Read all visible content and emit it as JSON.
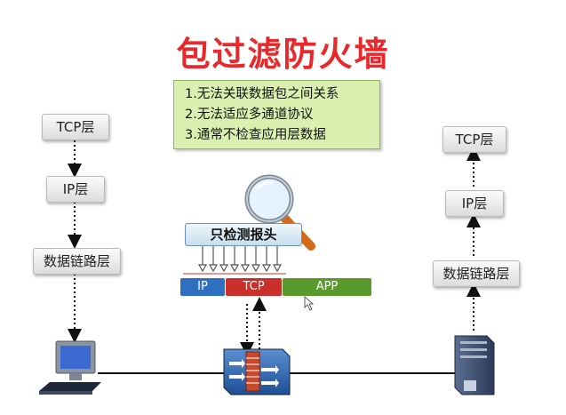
{
  "title": "包过滤防火墙",
  "notes": [
    "1.无法关联数据包之间关系",
    "2.无法适应多通道协议",
    "3.通常不检查应用层数据"
  ],
  "left_stack": {
    "tcp": "TCP层",
    "ip": "IP层",
    "link": "数据链路层"
  },
  "right_stack": {
    "tcp": "TCP层",
    "ip": "IP层",
    "link": "数据链路层"
  },
  "inspect_label": "只检测报头",
  "packet": {
    "ip": "IP",
    "tcp": "TCP",
    "app": "APP"
  },
  "colors": {
    "title": "#e8282b",
    "ip": "#2f6fc0",
    "tcp": "#c9302c",
    "app": "#5a9a2c",
    "note_bg": "#d9f0b0"
  },
  "icons": [
    "computer-icon",
    "firewall-icon",
    "server-icon",
    "magnifier-icon",
    "cursor-icon"
  ]
}
